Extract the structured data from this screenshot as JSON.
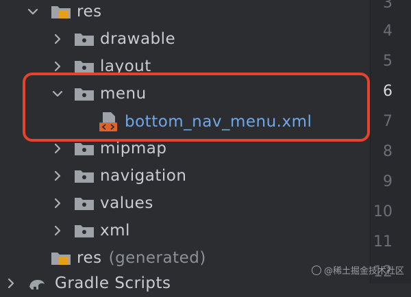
{
  "tree": {
    "items": [
      {
        "label": "res",
        "type": "res-folder",
        "expanded": true
      },
      {
        "label": "drawable",
        "type": "folder",
        "expanded": false
      },
      {
        "label": "layout",
        "type": "folder",
        "expanded": false
      },
      {
        "label": "menu",
        "type": "folder",
        "expanded": true
      },
      {
        "label": "bottom_nav_menu.xml",
        "type": "xml-file"
      },
      {
        "label": "mipmap",
        "type": "folder",
        "expanded": false
      },
      {
        "label": "navigation",
        "type": "folder",
        "expanded": false
      },
      {
        "label": "values",
        "type": "folder",
        "expanded": false
      },
      {
        "label": "xml",
        "type": "folder",
        "expanded": false
      },
      {
        "label": "res",
        "suffix": "(generated)",
        "type": "res-folder"
      },
      {
        "label": "Gradle Scripts",
        "type": "gradle",
        "expanded": false
      }
    ]
  },
  "gutter": {
    "line_numbers": [
      "3",
      "4",
      "5",
      "6",
      "7",
      "8",
      "9",
      "10",
      "11",
      "12"
    ],
    "active_line": "6"
  },
  "watermark": {
    "text": "@稀土掘金技术社区"
  },
  "colors": {
    "background": "#2b2d30",
    "highlight_border": "#e5432d",
    "file_text": "#6fa7e8",
    "folder_icon": "#9ea3a9",
    "xml_badge": "#e0622a"
  }
}
